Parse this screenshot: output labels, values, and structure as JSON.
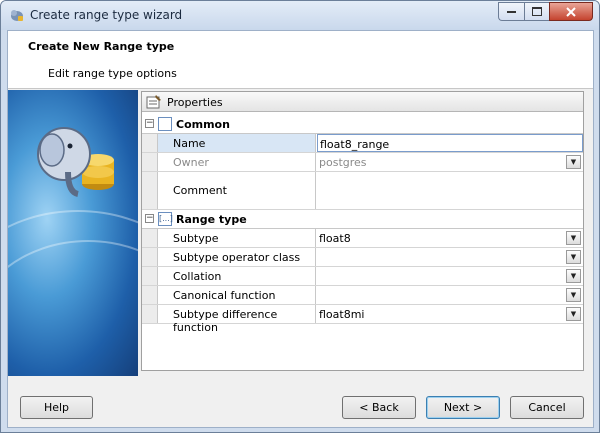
{
  "window": {
    "title": "Create range type wizard"
  },
  "header": {
    "title": "Create New Range type",
    "subtitle": "Edit range type options"
  },
  "properties": {
    "panel_label": "Properties",
    "categories": [
      {
        "label": "Common",
        "toggle": "−",
        "icon": "",
        "rows": [
          {
            "name": "Name",
            "value": "float8_range",
            "dropdown": false,
            "selected": true,
            "disabled": false
          },
          {
            "name": "Owner",
            "value": "postgres",
            "dropdown": true,
            "selected": false,
            "disabled": true
          },
          {
            "name": "Comment",
            "value": "",
            "dropdown": false,
            "selected": false,
            "disabled": false,
            "tall": true
          }
        ]
      },
      {
        "label": "Range type",
        "toggle": "−",
        "icon": "[...]",
        "rows": [
          {
            "name": "Subtype",
            "value": "float8",
            "dropdown": true
          },
          {
            "name": "Subtype operator class",
            "value": "",
            "dropdown": true
          },
          {
            "name": "Collation",
            "value": "",
            "dropdown": true
          },
          {
            "name": "Canonical function",
            "value": "",
            "dropdown": true
          },
          {
            "name": "Subtype difference function",
            "value": "float8mi",
            "dropdown": true
          }
        ]
      }
    ]
  },
  "footer": {
    "help": "Help",
    "back": "< Back",
    "next": "Next >",
    "cancel": "Cancel"
  },
  "icons": {
    "app": "elephant-icon",
    "properties": "properties-icon",
    "dropdown": "chevron-down-icon"
  },
  "colors": {
    "selection": "#d8e6f5",
    "banner": "#1e5fa9"
  }
}
